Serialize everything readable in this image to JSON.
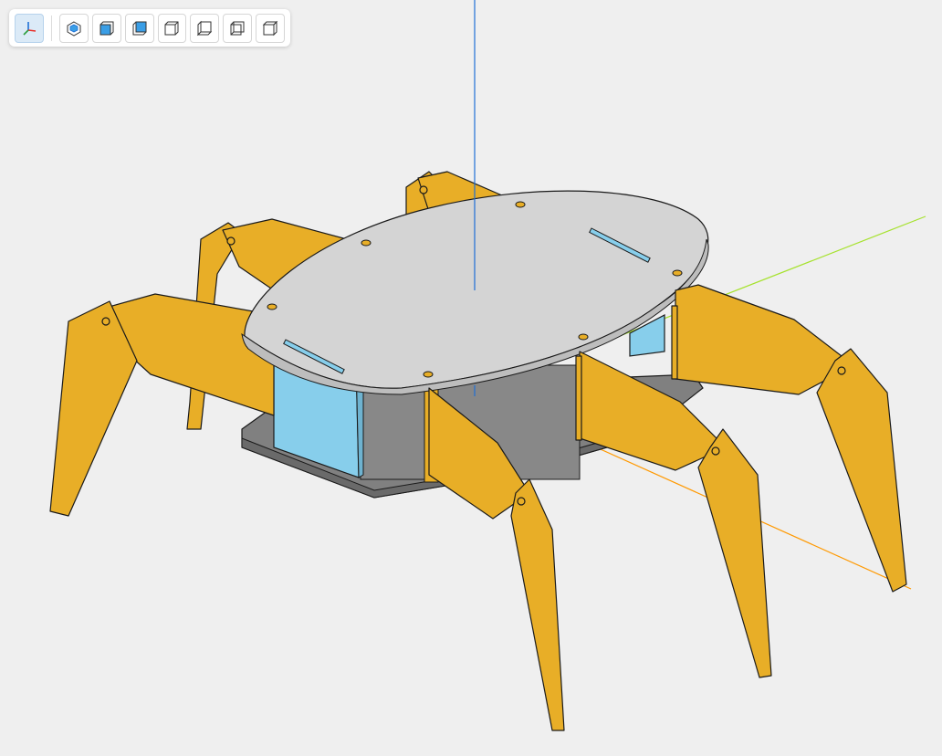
{
  "viewer": {
    "background": "#efefef",
    "axis_colors": {
      "x": "#ff9900",
      "y": "#a6e22e",
      "z": "#1f6fd6"
    }
  },
  "toolbar": {
    "buttons": [
      {
        "name": "axes-toggle",
        "icon": "axes-icon",
        "active": true
      },
      {
        "name": "view-iso",
        "icon": "iso-cube-icon"
      },
      {
        "name": "view-front",
        "icon": "cube-front-face-icon"
      },
      {
        "name": "view-back",
        "icon": "cube-back-face-icon"
      },
      {
        "name": "view-top",
        "icon": "cube-top-face-icon"
      },
      {
        "name": "view-bottom",
        "icon": "cube-bottom-face-icon"
      },
      {
        "name": "view-left",
        "icon": "cube-left-face-icon"
      },
      {
        "name": "view-right",
        "icon": "cube-right-face-icon"
      }
    ]
  },
  "model": {
    "name": "hexapod-robot",
    "colors": {
      "legs": "#e8ae27",
      "top_plate": "#d4d4d4",
      "bottom_plate": "#808080",
      "servos": "#87ceeb",
      "outline": "#1a1a1a"
    }
  }
}
